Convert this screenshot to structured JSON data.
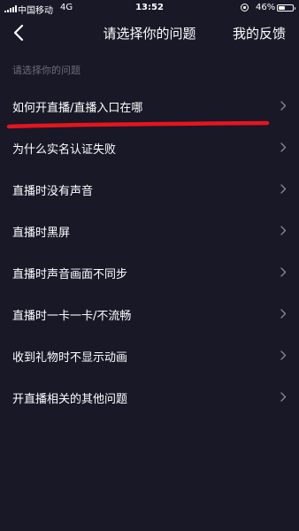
{
  "status_bar": {
    "carrier": "中国移动",
    "network": "4G",
    "time": "13:52",
    "battery_percent": "46%",
    "battery_level": 0.46
  },
  "nav": {
    "title": "请选择你的问题",
    "feedback_label": "我的反馈",
    "back_icon": "chevron-left-icon"
  },
  "section_label": "请选择你的问题",
  "questions": [
    {
      "label": "如何开直播/直播入口在哪"
    },
    {
      "label": "为什么实名认证失败"
    },
    {
      "label": "直播时没有声音"
    },
    {
      "label": "直播时黑屏"
    },
    {
      "label": "直播时声音画面不同步"
    },
    {
      "label": "直播时一卡一卡/不流畅"
    },
    {
      "label": "收到礼物时不显示动画"
    },
    {
      "label": "开直播相关的其他问题"
    }
  ],
  "colors": {
    "background": "#181827",
    "text": "#ffffff",
    "muted": "#6c6c7a",
    "annotation": "#e8141c"
  }
}
